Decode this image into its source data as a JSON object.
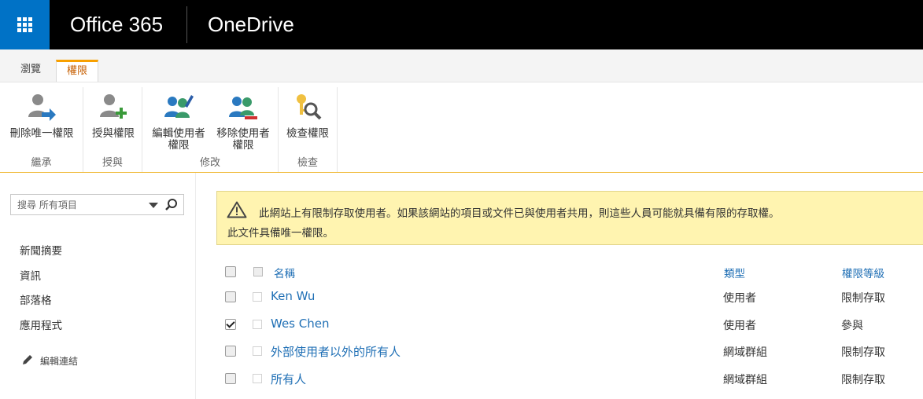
{
  "suite": {
    "product": "Office 365",
    "app": "OneDrive"
  },
  "tabs": [
    {
      "label": "瀏覽"
    },
    {
      "label": "權限"
    }
  ],
  "ribbon": {
    "groups": [
      {
        "label": "繼承",
        "buttons": [
          {
            "label": "刪除唯一權限"
          }
        ]
      },
      {
        "label": "授與",
        "buttons": [
          {
            "label": "授與權限"
          }
        ]
      },
      {
        "label": "修改",
        "buttons": [
          {
            "label_line1": "編輯使用者",
            "label_line2": "權限"
          },
          {
            "label_line1": "移除使用者",
            "label_line2": "權限"
          }
        ]
      },
      {
        "label": "檢查",
        "buttons": [
          {
            "label": "檢查權限"
          }
        ]
      }
    ]
  },
  "leftnav": {
    "search_placeholder": "搜尋 所有項目",
    "items": [
      {
        "label": "新聞摘要"
      },
      {
        "label": "資訊"
      },
      {
        "label": "部落格"
      },
      {
        "label": "應用程式"
      }
    ],
    "edit_links": "編輯連結"
  },
  "notice": {
    "line1": "此網站上有限制存取使用者。如果該網站的項目或文件已與使用者共用，則這些人員可能就具備有限的存取權。",
    "line2": "此文件具備唯一權限。"
  },
  "list": {
    "headers": {
      "name": "名稱",
      "type": "類型",
      "level": "權限等級"
    },
    "rows": [
      {
        "name": "Ken Wu",
        "type": "使用者",
        "level": "限制存取",
        "checked": false
      },
      {
        "name": "Wes Chen",
        "type": "使用者",
        "level": "參與",
        "checked": true
      },
      {
        "name": "外部使用者以外的所有人",
        "type": "網域群組",
        "level": "限制存取",
        "checked": false
      },
      {
        "name": "所有人",
        "type": "網域群組",
        "level": "限制存取",
        "checked": false
      }
    ]
  },
  "colors": {
    "suite_bar": "#000000",
    "waffle": "#0072c6",
    "accent_tab": "#f8a000",
    "link": "#1f6fb5",
    "notice_bg": "#fff4b0"
  }
}
